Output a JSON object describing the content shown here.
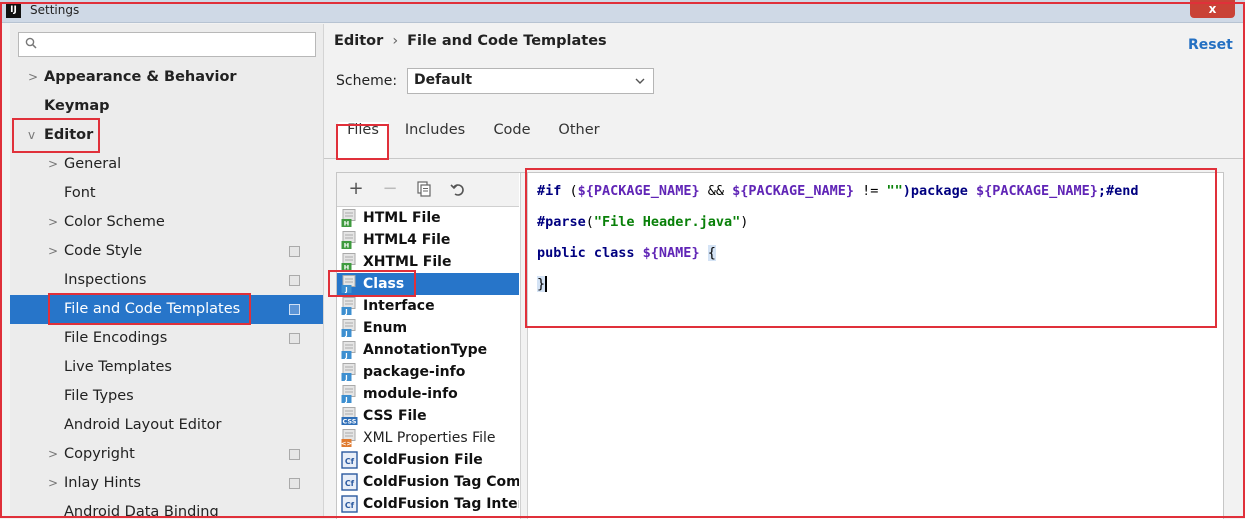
{
  "window": {
    "title": "Settings",
    "close_label": "x"
  },
  "search": {
    "placeholder": ""
  },
  "sidebar": {
    "items": [
      {
        "label": "Appearance & Behavior",
        "arrow": ">"
      },
      {
        "label": "Keymap",
        "arrow": ""
      },
      {
        "label": "Editor",
        "arrow": "v"
      },
      {
        "label": "General",
        "arrow": ">"
      },
      {
        "label": "Font",
        "arrow": ""
      },
      {
        "label": "Color Scheme",
        "arrow": ">"
      },
      {
        "label": "Code Style",
        "arrow": ">"
      },
      {
        "label": "Inspections",
        "arrow": ""
      },
      {
        "label": "File and Code Templates",
        "arrow": ""
      },
      {
        "label": "File Encodings",
        "arrow": ""
      },
      {
        "label": "Live Templates",
        "arrow": ""
      },
      {
        "label": "File Types",
        "arrow": ""
      },
      {
        "label": "Android Layout Editor",
        "arrow": ""
      },
      {
        "label": "Copyright",
        "arrow": ">"
      },
      {
        "label": "Inlay Hints",
        "arrow": ">"
      },
      {
        "label": "Android Data Binding",
        "arrow": ""
      }
    ]
  },
  "main": {
    "breadcrumb": {
      "parent": "Editor",
      "sep": "›",
      "current": "File and Code Templates"
    },
    "reset_label": "Reset",
    "scheme": {
      "label": "Scheme:",
      "value": "Default"
    },
    "tabs": [
      {
        "label": "Files"
      },
      {
        "label": "Includes"
      },
      {
        "label": "Code"
      },
      {
        "label": "Other"
      }
    ],
    "toolbar": {
      "add": "+",
      "remove": "−"
    },
    "files": [
      {
        "name": "HTML File",
        "icon": "html-file-icon",
        "tag": "H"
      },
      {
        "name": "HTML4 File",
        "icon": "html-file-icon",
        "tag": "H"
      },
      {
        "name": "XHTML File",
        "icon": "html-file-icon",
        "tag": "H"
      },
      {
        "name": "Class",
        "icon": "java-class-icon",
        "tag": "J"
      },
      {
        "name": "Interface",
        "icon": "java-file-icon",
        "tag": "J"
      },
      {
        "name": "Enum",
        "icon": "java-file-icon",
        "tag": "J"
      },
      {
        "name": "AnnotationType",
        "icon": "java-file-icon",
        "tag": "J"
      },
      {
        "name": "package-info",
        "icon": "java-file-icon",
        "tag": "J"
      },
      {
        "name": "module-info",
        "icon": "java-file-icon",
        "tag": "J"
      },
      {
        "name": "CSS File",
        "icon": "css-file-icon",
        "tag": "CSS"
      },
      {
        "name": "XML Properties File",
        "icon": "xml-file-icon",
        "tag": "<>"
      },
      {
        "name": "ColdFusion File",
        "icon": "coldfusion-file-icon",
        "tag": "Cf"
      },
      {
        "name": "ColdFusion Tag Compo",
        "icon": "coldfusion-file-icon",
        "tag": "Cf"
      },
      {
        "name": "ColdFusion Tag Interfa",
        "icon": "coldfusion-file-icon",
        "tag": "Cf"
      }
    ],
    "code": {
      "line1": {
        "kw": "#if",
        "p1": " (",
        "v1": "${PACKAGE_NAME}",
        "p2": " && ",
        "v2": "${PACKAGE_NAME}",
        "p3": " != ",
        "s1": "\"\"",
        "p4": ")package ",
        "v3": "${PACKAGE_NAME}",
        "p5": ";#end"
      },
      "line2": {
        "kw": "#parse",
        "p1": "(",
        "s1": "\"File Header.java\"",
        "p2": ")"
      },
      "line3": {
        "kw": "public class ",
        "v1": "${NAME}",
        "p1": " ",
        "brace": "{"
      },
      "line4": {
        "brace": "}"
      }
    }
  },
  "colors": {
    "selection": "#2775c9",
    "highlight_box": "#e0303a",
    "link": "#2470c2"
  }
}
